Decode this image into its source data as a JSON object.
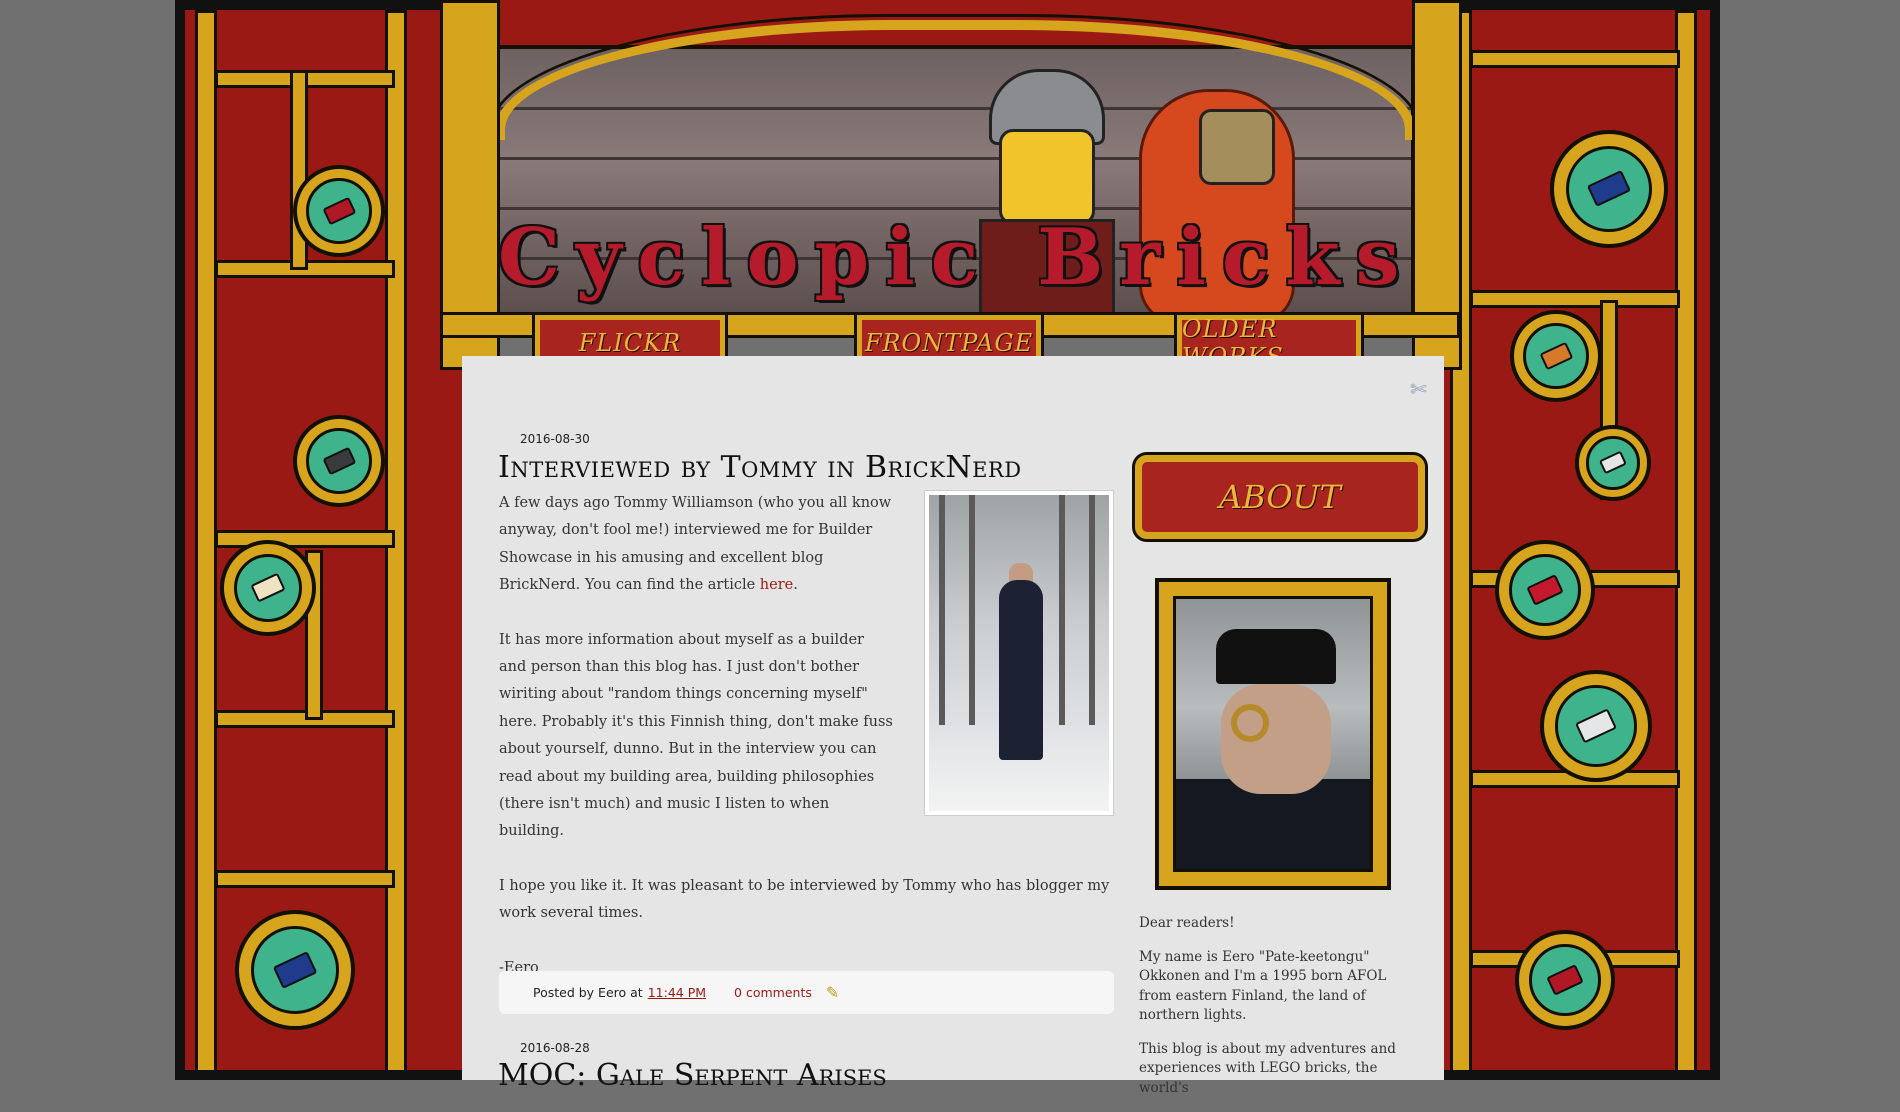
{
  "header": {
    "site_title": "Cyclopic Bricks"
  },
  "nav": {
    "items": [
      {
        "label": "FLICKR"
      },
      {
        "label": "FRONTPAGE"
      },
      {
        "label": "OLDER WORKS"
      }
    ]
  },
  "icons": {
    "tools": "wrench-screwdriver-icon",
    "edit": "pencil-icon"
  },
  "posts": [
    {
      "date": "2016-08-30",
      "title": "Interviewed by Tommy in BrickNerd",
      "paragraphs": [
        "A few days ago Tommy Williamson (who you all know anyway, don't fool me!) interviewed me for Builder Showcase in his amusing and excellent blog BrickNerd. You can find the article",
        "It has more information about myself as a builder and person than this blog has. I just don't bother wiriting about \"random things concerning myself\" here. Probably it's this Finnish thing, don't make fuss about yourself, dunno. But in the interview you can read about my building area, building philosophies (there isn't much) and music I listen to when building.",
        "I hope you like it. It was pleasant to be interviewed by Tommy who has blogger my work several times.",
        "-Eero"
      ],
      "link_text": "here",
      "after_link": ".",
      "footer": {
        "posted_by": "Posted by Eero at",
        "time": "11:44 PM",
        "comments": "0 comments"
      }
    },
    {
      "date": "2016-08-28",
      "title": "MOC: Gale Serpent Arises"
    }
  ],
  "sidebar": {
    "about_label": "ABOUT",
    "paragraphs": [
      "Dear readers!",
      "My name is Eero \"Pate-keetongu\" Okkonen and I'm a 1995 born AFOL from eastern Finland, the land of northern lights.",
      "This blog is about my adventures and experiences with LEGO bricks, the world's"
    ]
  },
  "colors": {
    "frame_red": "#9a1914",
    "pipe_gold": "#d7a41e",
    "porthole_green": "#3fb38b",
    "link_red": "#9a1914",
    "background_gray": "#717071",
    "content_gray": "#e5e5e5"
  }
}
